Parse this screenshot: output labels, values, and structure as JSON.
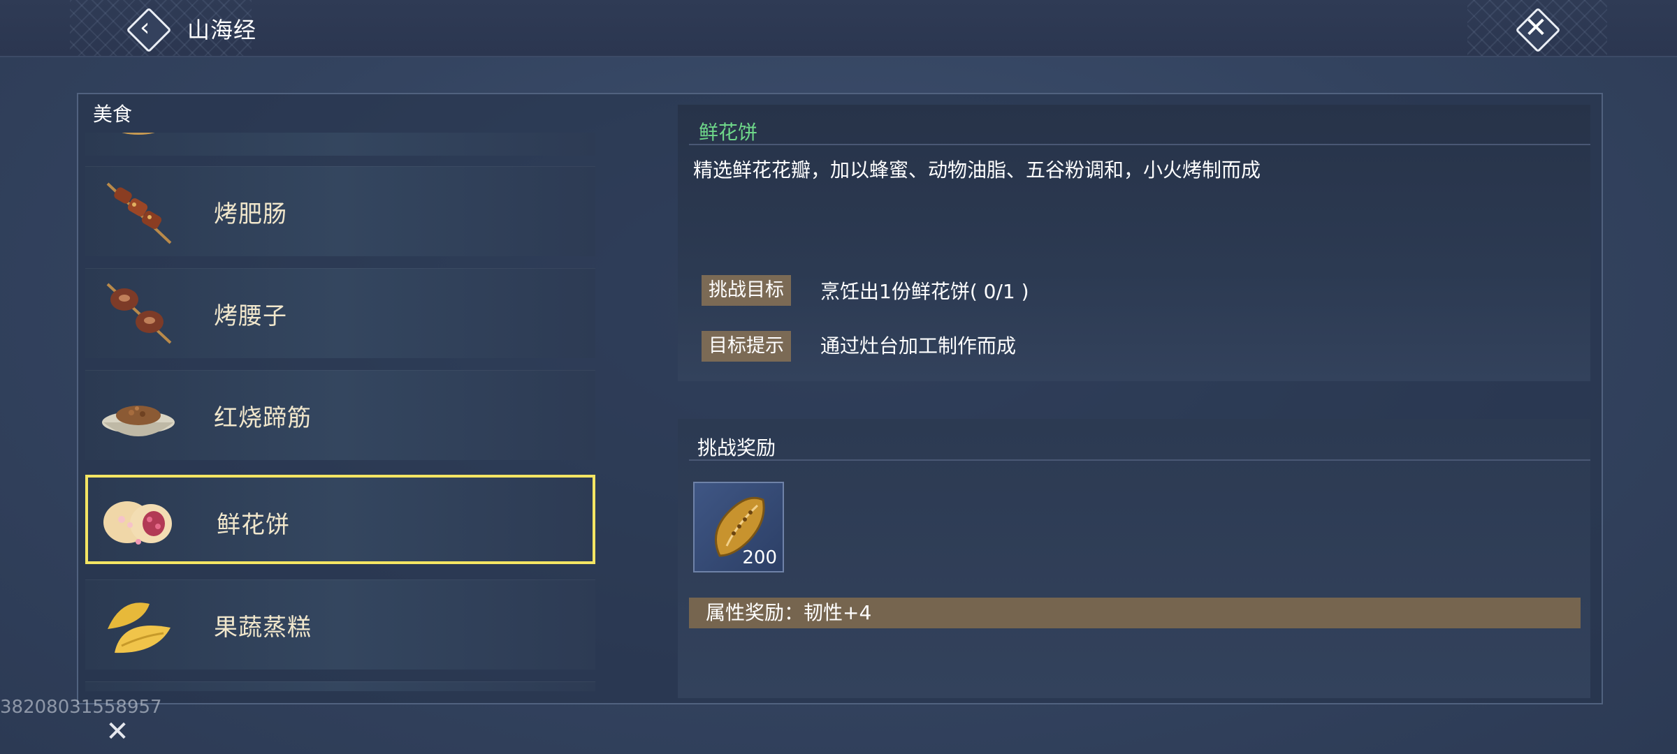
{
  "header": {
    "title": "山海经",
    "back_icon": "back-chevron-icon",
    "close_icon": "close-icon"
  },
  "category": "美食",
  "list": {
    "items": [
      {
        "label": "烤肥肠",
        "icon": "grilled-intestine-skewer-icon"
      },
      {
        "label": "烤腰子",
        "icon": "grilled-kidney-skewer-icon"
      },
      {
        "label": "红烧蹄筋",
        "icon": "braised-tendon-bowl-icon"
      },
      {
        "label": "鲜花饼",
        "icon": "flower-cake-icon",
        "selected": true
      },
      {
        "label": "果蔬蒸糕",
        "icon": "steamed-dumpling-icon"
      }
    ]
  },
  "detail": {
    "name": "鲜花饼",
    "description": "精选鲜花花瓣，加以蜂蜜、动物油脂、五谷粉调和，小火烤制而成",
    "goal_tag": "挑战目标",
    "goal_text": "烹饪出1份鲜花饼( 0/1 )",
    "hint_tag": "目标提示",
    "hint_text": "通过灶台加工制作而成"
  },
  "reward": {
    "title": "挑战奖励",
    "item_icon": "gold-seed-icon",
    "item_count": "200",
    "attribute": "属性奖励：韧性+4"
  },
  "footer": {
    "uid": "38208031558957"
  },
  "colors": {
    "selected_border": "#f4e563",
    "item_name": "#f1e7cc",
    "detail_title": "#6fd88a",
    "tag_bg": "#7b6a55"
  }
}
